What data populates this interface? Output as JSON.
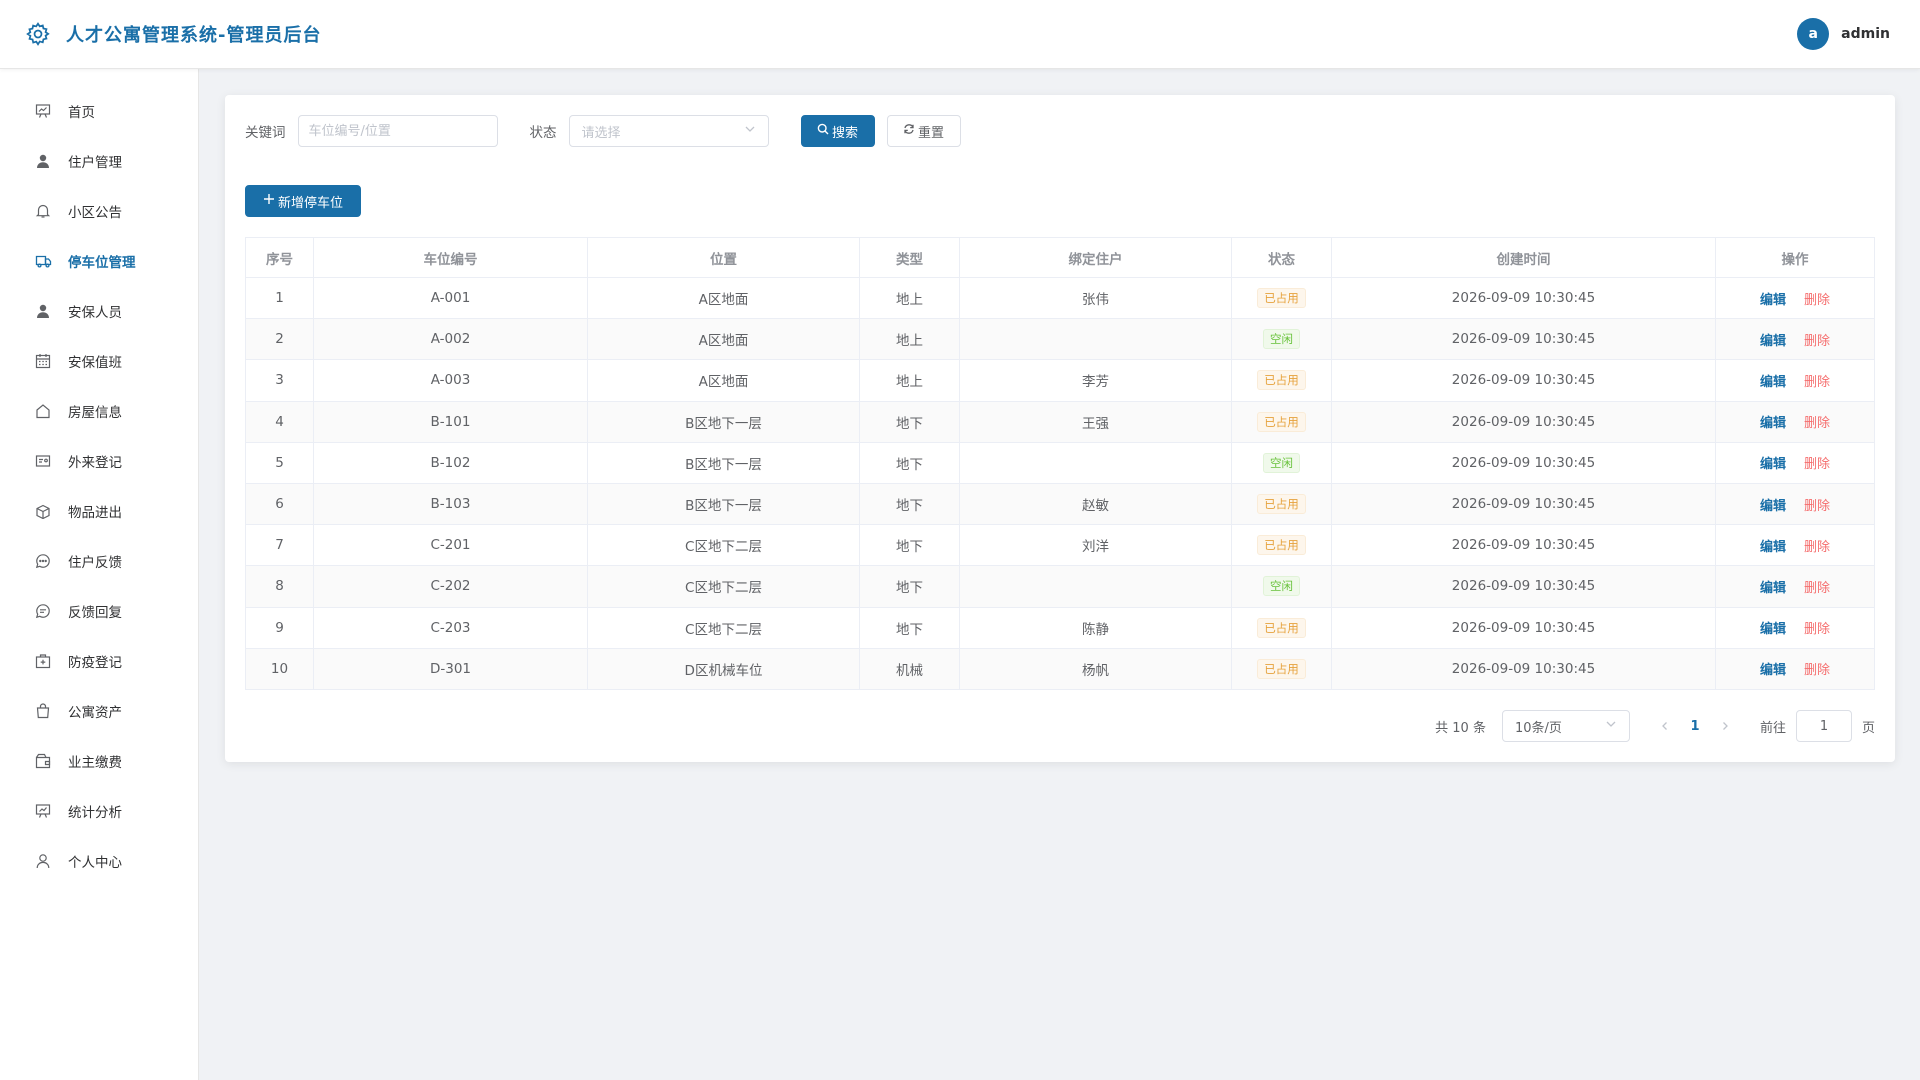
{
  "header": {
    "title": "人才公寓管理系统-管理员后台",
    "avatar_letter": "a",
    "username": "admin",
    "brand_color": "#1a6fa8"
  },
  "sidebar": {
    "items": [
      {
        "label": "首页",
        "icon": "chart-board-icon"
      },
      {
        "label": "住户管理",
        "icon": "user-filled-icon"
      },
      {
        "label": "小区公告",
        "icon": "bell-icon"
      },
      {
        "label": "停车位管理",
        "icon": "van-icon",
        "active": true
      },
      {
        "label": "安保人员",
        "icon": "user-filled-icon"
      },
      {
        "label": "安保值班",
        "icon": "calendar-icon"
      },
      {
        "label": "房屋信息",
        "icon": "house-icon"
      },
      {
        "label": "外来登记",
        "icon": "id-card-icon"
      },
      {
        "label": "物品进出",
        "icon": "box-icon"
      },
      {
        "label": "住户反馈",
        "icon": "chat-dots-icon"
      },
      {
        "label": "反馈回复",
        "icon": "chat-lines-icon"
      },
      {
        "label": "防疫登记",
        "icon": "first-aid-kit-icon"
      },
      {
        "label": "公寓资产",
        "icon": "shopping-bag-icon"
      },
      {
        "label": "业主缴费",
        "icon": "wallet-icon"
      },
      {
        "label": "统计分析",
        "icon": "presentation-icon"
      },
      {
        "label": "个人中心",
        "icon": "user-outline-icon"
      }
    ]
  },
  "filters": {
    "keyword_label": "关键词",
    "keyword_placeholder": "车位编号/位置",
    "status_label": "状态",
    "status_placeholder": "请选择",
    "search_label": "搜索",
    "reset_label": "重置"
  },
  "add_button_label": "新增停车位",
  "table": {
    "headers": [
      "序号",
      "车位编号",
      "位置",
      "类型",
      "绑定住户",
      "状态",
      "创建时间",
      "操作"
    ],
    "edit_label": "编辑",
    "delete_label": "删除",
    "rows": [
      {
        "index": "1",
        "code": "A-001",
        "location": "A区地面",
        "type": "地上",
        "resident": "张伟",
        "status": "已占用",
        "status_kind": "occupied",
        "created": "2026-09-09 10:30:45"
      },
      {
        "index": "2",
        "code": "A-002",
        "location": "A区地面",
        "type": "地上",
        "resident": "",
        "status": "空闲",
        "status_kind": "free",
        "created": "2026-09-09 10:30:45"
      },
      {
        "index": "3",
        "code": "A-003",
        "location": "A区地面",
        "type": "地上",
        "resident": "李芳",
        "status": "已占用",
        "status_kind": "occupied",
        "created": "2026-09-09 10:30:45"
      },
      {
        "index": "4",
        "code": "B-101",
        "location": "B区地下一层",
        "type": "地下",
        "resident": "王强",
        "status": "已占用",
        "status_kind": "occupied",
        "created": "2026-09-09 10:30:45"
      },
      {
        "index": "5",
        "code": "B-102",
        "location": "B区地下一层",
        "type": "地下",
        "resident": "",
        "status": "空闲",
        "status_kind": "free",
        "created": "2026-09-09 10:30:45"
      },
      {
        "index": "6",
        "code": "B-103",
        "location": "B区地下一层",
        "type": "地下",
        "resident": "赵敏",
        "status": "已占用",
        "status_kind": "occupied",
        "created": "2026-09-09 10:30:45"
      },
      {
        "index": "7",
        "code": "C-201",
        "location": "C区地下二层",
        "type": "地下",
        "resident": "刘洋",
        "status": "已占用",
        "status_kind": "occupied",
        "created": "2026-09-09 10:30:45"
      },
      {
        "index": "8",
        "code": "C-202",
        "location": "C区地下二层",
        "type": "地下",
        "resident": "",
        "status": "空闲",
        "status_kind": "free",
        "created": "2026-09-09 10:30:45"
      },
      {
        "index": "9",
        "code": "C-203",
        "location": "C区地下二层",
        "type": "地下",
        "resident": "陈静",
        "status": "已占用",
        "status_kind": "occupied",
        "created": "2026-09-09 10:30:45"
      },
      {
        "index": "10",
        "code": "D-301",
        "location": "D区机械车位",
        "type": "机械",
        "resident": "杨帆",
        "status": "已占用",
        "status_kind": "occupied",
        "created": "2026-09-09 10:30:45"
      }
    ]
  },
  "pagination": {
    "total_text": "共 10 条",
    "page_size": "10条/页",
    "current_page": "1",
    "goto_label": "前往",
    "goto_value": "1",
    "page_suffix": "页"
  }
}
